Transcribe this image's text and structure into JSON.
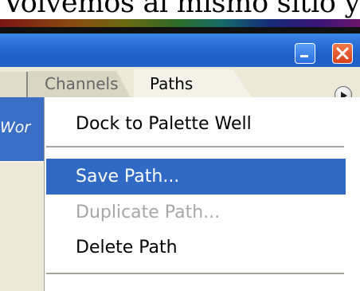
{
  "caption": {
    "text": "Volvemos al mismo sitio y damos"
  },
  "window": {
    "minimize_icon": "minimize-icon",
    "close_icon": "close-icon"
  },
  "tabs": [
    {
      "label": "Channels",
      "active": false
    },
    {
      "label": "Paths",
      "active": true
    }
  ],
  "palette_menu_icon": "triangle-right-icon",
  "path_list": {
    "visible_item": "Wor"
  },
  "menu": {
    "items": [
      {
        "label": "Dock to Palette Well",
        "state": "normal"
      },
      {
        "label": "Save Path...",
        "state": "highlighted"
      },
      {
        "label": "Duplicate Path...",
        "state": "disabled"
      },
      {
        "label": "Delete Path",
        "state": "normal"
      }
    ]
  },
  "colors": {
    "selection": "#316ac5",
    "titlebar": "#2a6fd6",
    "close": "#d8401a",
    "panel": "#ece9d8"
  }
}
